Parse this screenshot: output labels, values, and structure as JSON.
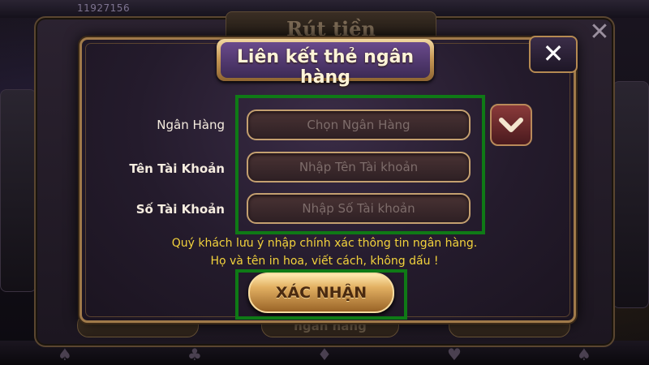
{
  "background": {
    "counter": "11927156",
    "back_dialog_title": "Rút tiền",
    "back_footer_label": "ngân hàng"
  },
  "dialog": {
    "title": "Liên kết thẻ ngân hàng",
    "close_icon": "close-icon",
    "fields": [
      {
        "label": "Ngân Hàng",
        "placeholder": "Chọn Ngân Hàng",
        "value": ""
      },
      {
        "label": "Tên Tài Khoản",
        "placeholder": "Nhập Tên Tài khoản",
        "value": ""
      },
      {
        "label": "Số Tài Khoản",
        "placeholder": "Nhập Số Tài khoản",
        "value": ""
      }
    ],
    "dropdown_icon": "chevron-down-icon",
    "notice_line1": "Quý khách lưu ý nhập chính xác thông tin ngân hàng.",
    "notice_line2": "Họ và tên in hoa, viết cách, không dấu !",
    "confirm_label": "XÁC NHẬN"
  },
  "colors": {
    "highlight_box": "#0f7a16",
    "notice_text": "#f2d23c",
    "gold_accent": "#c4a070"
  }
}
